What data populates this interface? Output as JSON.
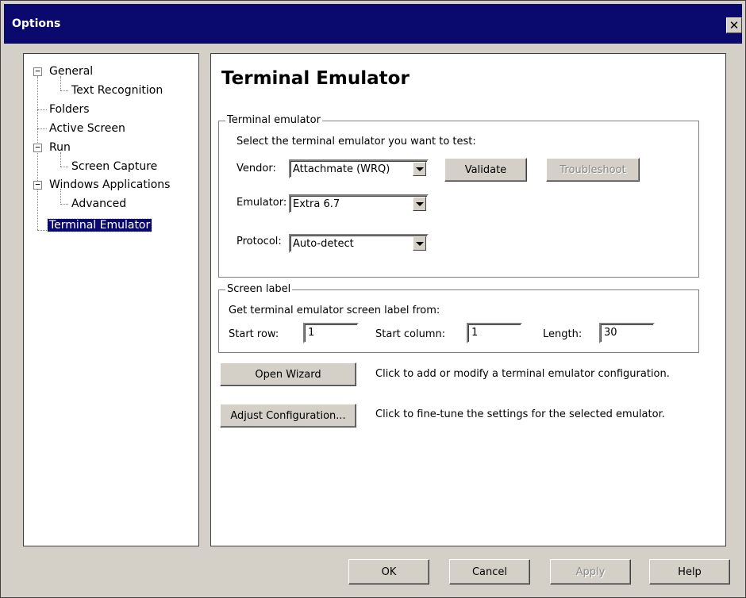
{
  "window": {
    "title": "Options",
    "close_glyph": "✕"
  },
  "tree": {
    "items": [
      {
        "label": "General",
        "expander": "−"
      },
      {
        "label": "Text Recognition"
      },
      {
        "label": "Folders"
      },
      {
        "label": "Active Screen"
      },
      {
        "label": "Run",
        "expander": "−"
      },
      {
        "label": "Screen Capture"
      },
      {
        "label": "Windows Applications",
        "expander": "−"
      },
      {
        "label": "Advanced"
      },
      {
        "label": "Terminal Emulator",
        "selected": true
      }
    ]
  },
  "page": {
    "title": "Terminal Emulator",
    "terminal_group": {
      "label": "Terminal emulator",
      "prompt": "Select the terminal emulator you want to test:",
      "vendor_label": "Vendor:",
      "vendor_value": "Attachmate (WRQ)",
      "emulator_label": "Emulator:",
      "emulator_value": "Extra 6.7",
      "protocol_label": "Protocol:",
      "protocol_value": "Auto-detect",
      "validate_label": "Validate",
      "troubleshoot_label": "Troubleshoot"
    },
    "screen_label_group": {
      "label": "Screen label",
      "prompt": "Get terminal emulator screen label from:",
      "start_row_label": "Start row:",
      "start_row_value": "1",
      "start_column_label": "Start column:",
      "start_column_value": "1",
      "length_label": "Length:",
      "length_value": "30"
    },
    "open_wizard": {
      "button_label": "Open Wizard",
      "description": "Click to add or modify a terminal emulator configuration."
    },
    "adjust_config": {
      "button_label": "Adjust Configuration...",
      "description": "Click to fine-tune the settings for the selected emulator."
    }
  },
  "footer": {
    "ok_label": "OK",
    "cancel_label": "Cancel",
    "apply_label": "Apply",
    "help_label": "Help"
  },
  "colors": {
    "titlebar": "#0a0a6e",
    "window_face": "#d4d0c8",
    "selection": "#0a0a6e"
  }
}
